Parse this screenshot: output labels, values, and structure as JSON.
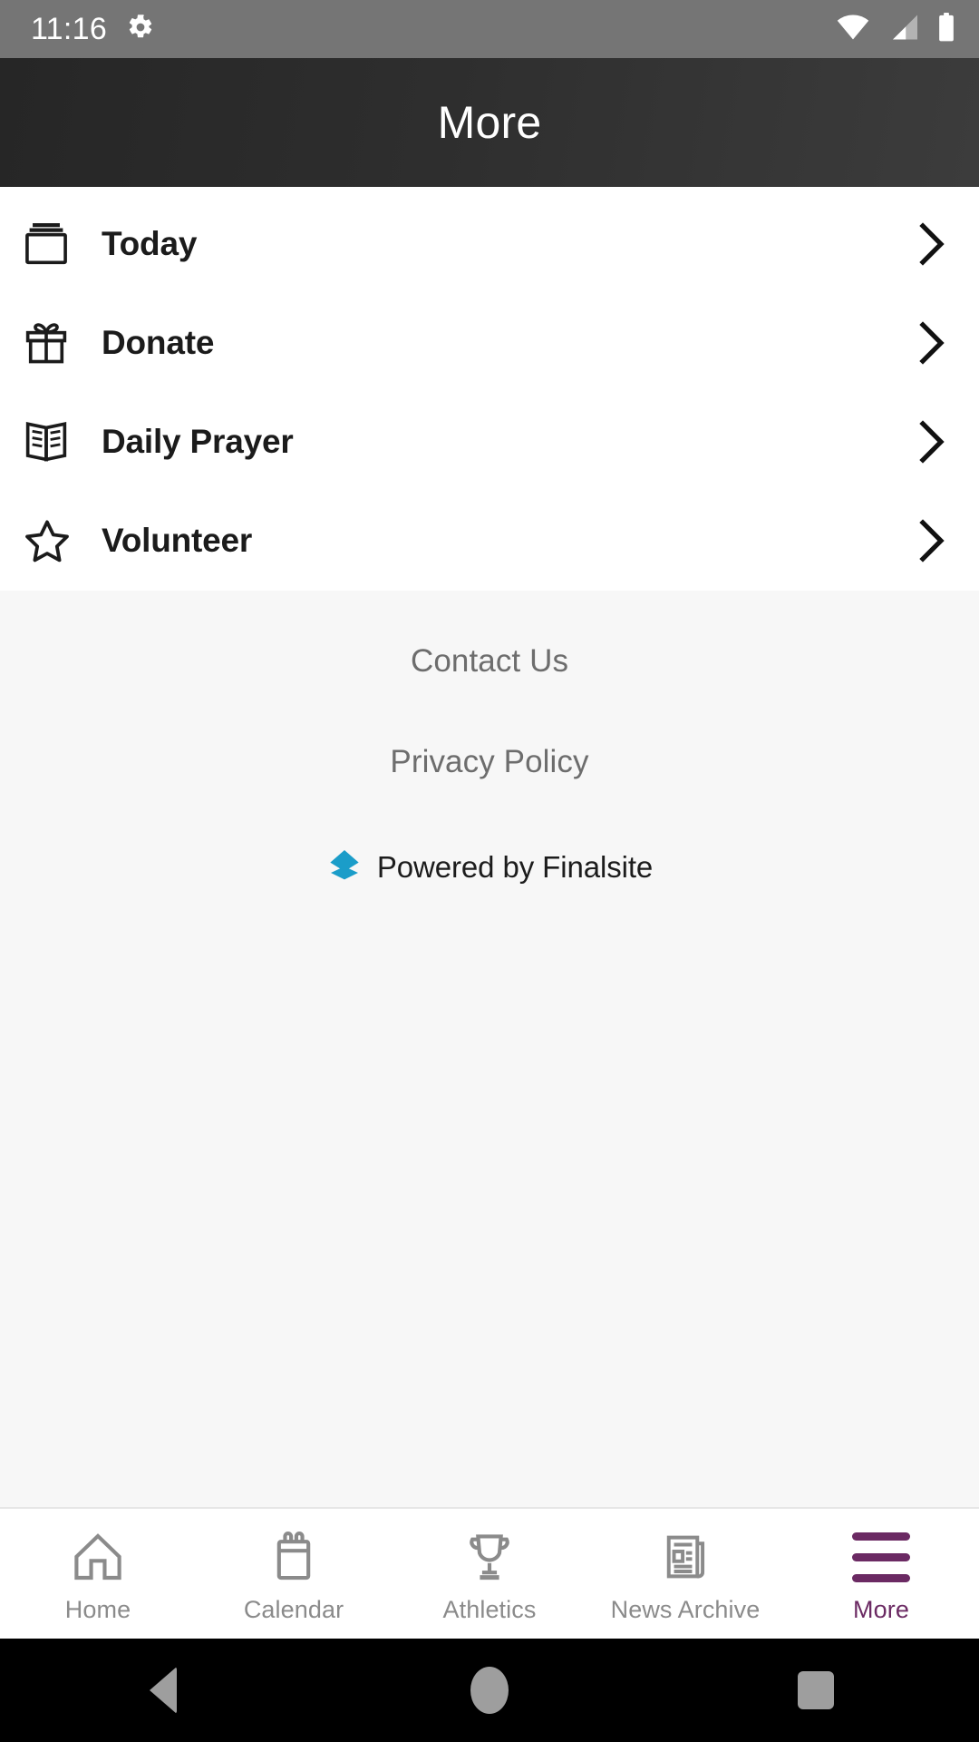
{
  "status_bar": {
    "time": "11:16",
    "icons": [
      "gear-icon",
      "wifi-icon",
      "cellular-signal-icon",
      "battery-icon"
    ],
    "background_color": "#757575",
    "foreground_color": "#ffffff"
  },
  "header": {
    "title": "More",
    "background_gradient": [
      "#262626",
      "#3c3c3c"
    ],
    "title_color": "#ffffff"
  },
  "menu": {
    "items": [
      {
        "label": "Today",
        "icon": "day-view-icon",
        "chevron": "chevron-right-icon"
      },
      {
        "label": "Donate",
        "icon": "gift-icon",
        "chevron": "chevron-right-icon"
      },
      {
        "label": "Daily Prayer",
        "icon": "open-book-icon",
        "chevron": "chevron-right-icon"
      },
      {
        "label": "Volunteer",
        "icon": "star-icon",
        "chevron": "chevron-right-icon"
      }
    ]
  },
  "footer": {
    "contact_label": "Contact Us",
    "privacy_label": "Privacy Policy",
    "powered_label": "Powered by Finalsite",
    "powered_logo": "finalsite-stacked-diamond-logo",
    "background_color": "#f7f7f7",
    "link_color": "#6d6d6d",
    "logo_color": "#1b9dc9"
  },
  "tab_bar": {
    "accent_color": "#6b2a63",
    "inactive_color": "#8b8b8b",
    "tabs": [
      {
        "label": "Home",
        "icon": "home-icon",
        "active": false
      },
      {
        "label": "Calendar",
        "icon": "calendar-icon",
        "active": false
      },
      {
        "label": "Athletics",
        "icon": "trophy-icon",
        "active": false
      },
      {
        "label": "News Archive",
        "icon": "newspaper-icon",
        "active": false
      },
      {
        "label": "More",
        "icon": "hamburger-icon",
        "active": true
      }
    ]
  },
  "system_nav": {
    "buttons": [
      "back-triangle-icon",
      "home-circle-icon",
      "recents-square-icon"
    ],
    "background_color": "#000000",
    "icon_color": "#9e9e9e"
  }
}
